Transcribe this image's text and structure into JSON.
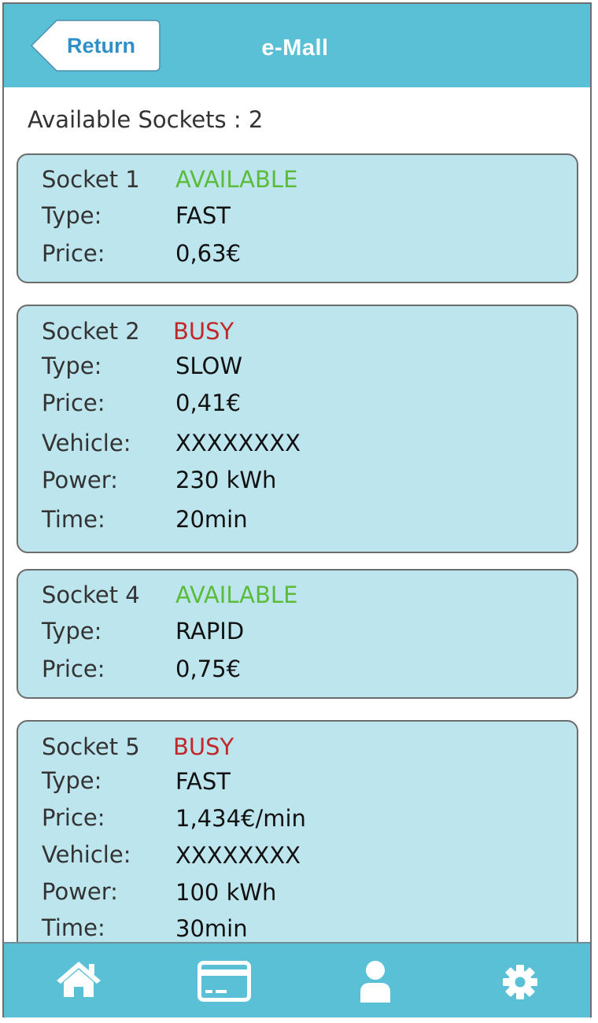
{
  "header": {
    "return_label": "Return",
    "title": "e-Mall"
  },
  "summary": {
    "available_sockets": "Available Sockets : 2"
  },
  "sockets": [
    {
      "name": "Socket 1",
      "status": "AVAILABLE",
      "rows": [
        {
          "label": "Type:",
          "value": "FAST"
        },
        {
          "label": "Price:",
          "value": "0,63€"
        }
      ]
    },
    {
      "name": "Socket 2",
      "status": "BUSY",
      "rows": [
        {
          "label": "Type:",
          "value": "SLOW"
        },
        {
          "label": "Price:",
          "value": "0,41€"
        },
        {
          "label": "Vehicle:",
          "value": "XXXXXXXX"
        },
        {
          "label": "Power:",
          "value": "230 kWh"
        },
        {
          "label": "Time:",
          "value": "20min"
        }
      ]
    },
    {
      "name": "Socket 4",
      "status": "AVAILABLE",
      "rows": [
        {
          "label": "Type:",
          "value": "RAPID"
        },
        {
          "label": "Price:",
          "value": "0,75€"
        }
      ]
    },
    {
      "name": "Socket 5",
      "status": "BUSY",
      "rows": [
        {
          "label": "Type:",
          "value": "FAST"
        },
        {
          "label": "Price:",
          "value": "1,434€/min"
        },
        {
          "label": "Vehicle:",
          "value": "XXXXXXXX"
        },
        {
          "label": "Power:",
          "value": "100 kWh"
        },
        {
          "label": "Time:",
          "value": "30min"
        }
      ]
    }
  ],
  "footer": {
    "icons": [
      "home-icon",
      "card-icon",
      "user-icon",
      "gear-icon"
    ]
  },
  "colors": {
    "header_bg": "#5ac0d6",
    "card_bg": "#bde5ee",
    "available": "#5bbb3b",
    "busy": "#c0282a",
    "return_text": "#2f8fc9"
  }
}
